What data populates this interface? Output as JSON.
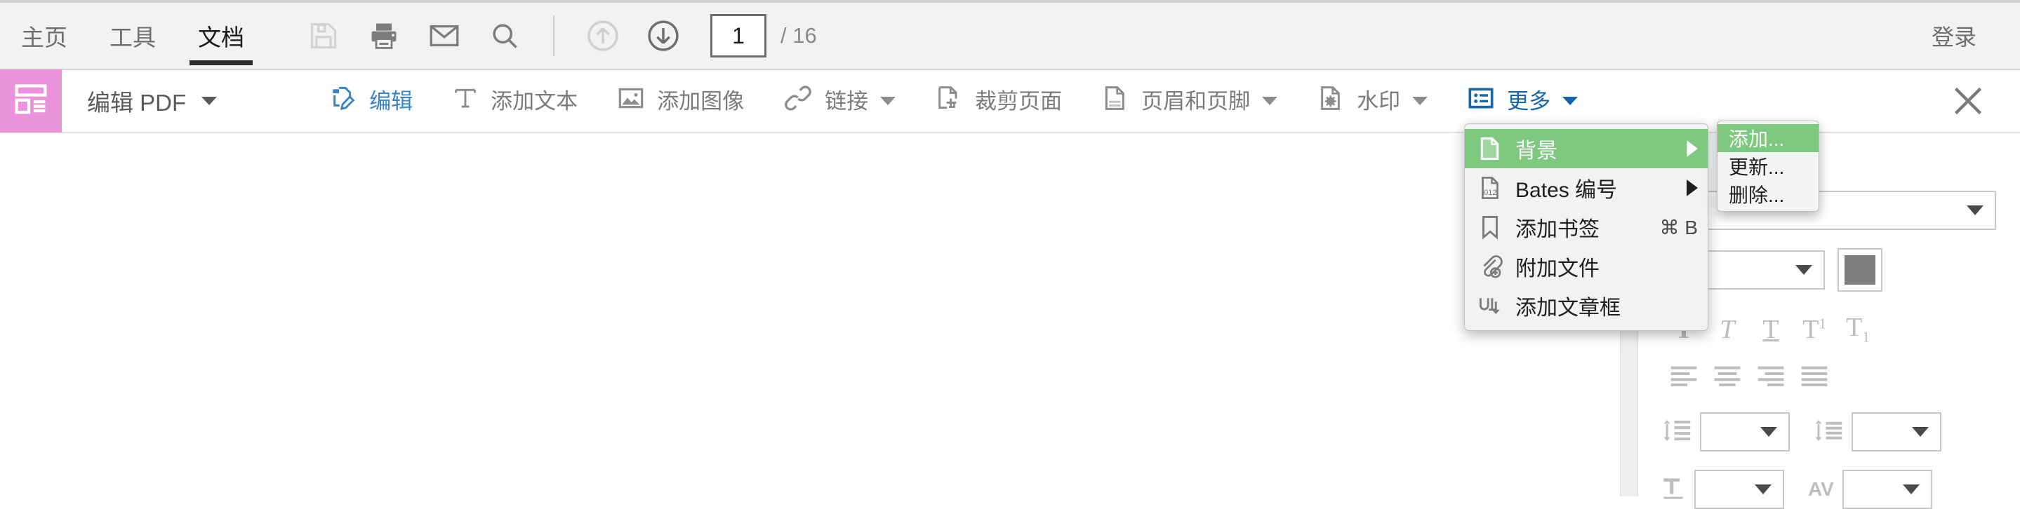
{
  "topbar": {
    "tabs": [
      {
        "label": "主页",
        "active": false
      },
      {
        "label": "工具",
        "active": false
      },
      {
        "label": "文档",
        "active": true
      }
    ],
    "quick_actions": [
      {
        "name": "save-icon",
        "label": "保存"
      },
      {
        "name": "print-icon",
        "label": "打印"
      },
      {
        "name": "email-icon",
        "label": "邮件"
      },
      {
        "name": "search-icon",
        "label": "搜索"
      }
    ],
    "page_nav": {
      "prev_label": "上一页",
      "next_label": "下一页",
      "current_page": "1",
      "total_pages": "/ 16"
    },
    "login_label": "登录"
  },
  "toolbar": {
    "mode_icon": "layout-edit-icon",
    "mode_label": "编辑 PDF",
    "close_label": "关闭",
    "items": [
      {
        "label": "编辑",
        "icon": "edit-document-icon",
        "state": "active",
        "caret": false
      },
      {
        "label": "添加文本",
        "icon": "add-text-icon",
        "state": "normal",
        "caret": false
      },
      {
        "label": "添加图像",
        "icon": "add-image-icon",
        "state": "normal",
        "caret": false
      },
      {
        "label": "链接",
        "icon": "link-icon",
        "state": "normal",
        "caret": true
      },
      {
        "label": "裁剪页面",
        "icon": "crop-page-icon",
        "state": "normal",
        "caret": false
      },
      {
        "label": "页眉和页脚",
        "icon": "header-footer-icon",
        "state": "normal",
        "caret": true
      },
      {
        "label": "水印",
        "icon": "watermark-icon",
        "state": "normal",
        "caret": true
      },
      {
        "label": "更多",
        "icon": "more-list-icon",
        "state": "open",
        "caret": true
      }
    ]
  },
  "more_menu": {
    "items": [
      {
        "label": "背景",
        "icon": "background-page-icon",
        "shortcut": "",
        "submenu": true,
        "highlighted": true
      },
      {
        "label": "Bates 编号",
        "icon": "bates-number-icon",
        "shortcut": "",
        "submenu": true,
        "highlighted": false
      },
      {
        "label": "添加书签",
        "icon": "bookmark-icon",
        "shortcut": "⌘ B",
        "submenu": false,
        "highlighted": false
      },
      {
        "label": "附加文件",
        "icon": "attach-file-icon",
        "shortcut": "",
        "submenu": false,
        "highlighted": false
      },
      {
        "label": "添加文章框",
        "icon": "article-box-icon",
        "shortcut": "",
        "submenu": false,
        "highlighted": false
      }
    ]
  },
  "background_submenu": {
    "items": [
      {
        "label": "添加...",
        "highlighted": true
      },
      {
        "label": "更新...",
        "highlighted": false
      },
      {
        "label": "删除...",
        "highlighted": false
      }
    ]
  },
  "right_panel": {
    "font_family": {
      "value": "",
      "placeholder": ""
    },
    "font_size": {
      "value": "",
      "placeholder": ""
    },
    "font_color_hex": "#7d7d7d",
    "style_buttons": [
      {
        "name": "bold-button",
        "glyph": "T"
      },
      {
        "name": "italic-button",
        "glyph": "T"
      },
      {
        "name": "underline-button",
        "glyph": "T"
      },
      {
        "name": "superscript-button",
        "glyph": "T"
      },
      {
        "name": "subscript-button",
        "glyph": "T"
      }
    ],
    "align_buttons": [
      {
        "name": "align-left-button"
      },
      {
        "name": "align-center-button"
      },
      {
        "name": "align-right-button"
      },
      {
        "name": "align-justify-button"
      }
    ],
    "line_spacing": {
      "value": ""
    },
    "paragraph_spacing": {
      "value": ""
    },
    "char_scale": {
      "value": ""
    },
    "char_spacing": {
      "value": ""
    },
    "char_spacing_label": "AV"
  },
  "colors": {
    "accent_pink": "#eb92dd",
    "accent_blue": "#3884c6",
    "menu_highlight_green": "#7dc97f",
    "toolbar_grey": "#f2f2f2",
    "text_grey": "#7b7b7b"
  }
}
